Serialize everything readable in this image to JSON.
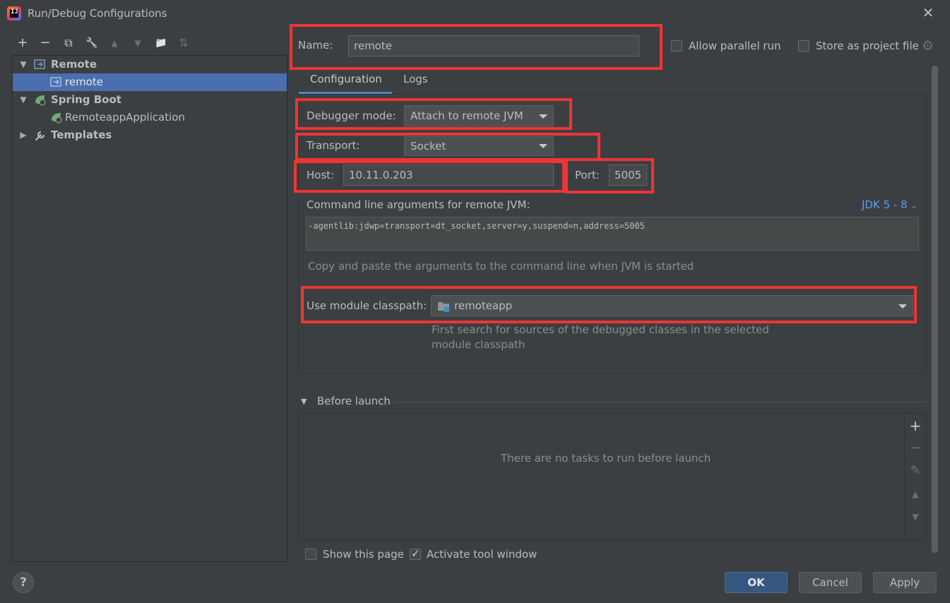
{
  "window": {
    "title": "Run/Debug Configurations",
    "close_glyph": "✕"
  },
  "toolbar": {
    "add": "+",
    "remove": "−",
    "copy": "⧉",
    "wrench": "🔧",
    "up": "▲",
    "down": "▼",
    "folder": "📁",
    "sort": "⇅"
  },
  "tree": {
    "items": [
      {
        "label": "Remote",
        "icon": "remote-config-icon",
        "expanded": true
      },
      {
        "label": "remote",
        "icon": "remote-config-icon",
        "selected": true
      },
      {
        "label": "Spring Boot",
        "icon": "spring-boot-icon",
        "expanded": true
      },
      {
        "label": "RemoteappApplication",
        "icon": "spring-boot-icon"
      },
      {
        "label": "Templates",
        "icon": "wrench-icon",
        "expanded": false
      }
    ]
  },
  "name": {
    "label": "Name:",
    "value": "remote"
  },
  "allow_parallel_run": {
    "label": "Allow parallel run",
    "checked": false
  },
  "store_as_project_file": {
    "label": "Store as project file",
    "checked": false
  },
  "tabs": [
    {
      "label": "Configuration",
      "active": true
    },
    {
      "label": "Logs",
      "active": false
    }
  ],
  "debugger_mode": {
    "label": "Debugger mode:",
    "value": "Attach to remote JVM"
  },
  "transport": {
    "label": "Transport:",
    "value": "Socket"
  },
  "host": {
    "label": "Host:",
    "value": "10.11.0.203"
  },
  "port": {
    "label": "Port:",
    "value": "5005"
  },
  "command_line": {
    "label": "Command line arguments for remote JVM:",
    "jdk_link": "JDK 5 - 8",
    "value": "-agentlib:jdwp=transport=dt_socket,server=y,suspend=n,address=5005",
    "hint": "Copy and paste the arguments to the command line when JVM is started"
  },
  "module_classpath": {
    "label": "Use module classpath:",
    "value": "remoteapp",
    "hint_line1": "First search for sources of the debugged classes in the selected",
    "hint_line2": "module classpath"
  },
  "before_launch": {
    "label": "Before launch",
    "empty_text": "There are no tasks to run before launch",
    "add": "+",
    "remove": "−",
    "edit": "✎",
    "up": "▲",
    "down": "▼"
  },
  "show_this_page": {
    "label": "Show this page",
    "checked": false
  },
  "activate_tool_window": {
    "label": "Activate tool window",
    "checked": true
  },
  "buttons": {
    "help": "?",
    "ok": "OK",
    "cancel": "Cancel",
    "apply": "Apply"
  },
  "colors": {
    "highlight_red": "#ee3535",
    "selection_blue": "#4b6eaf",
    "link_blue": "#589df6",
    "background": "#3c3f41"
  }
}
